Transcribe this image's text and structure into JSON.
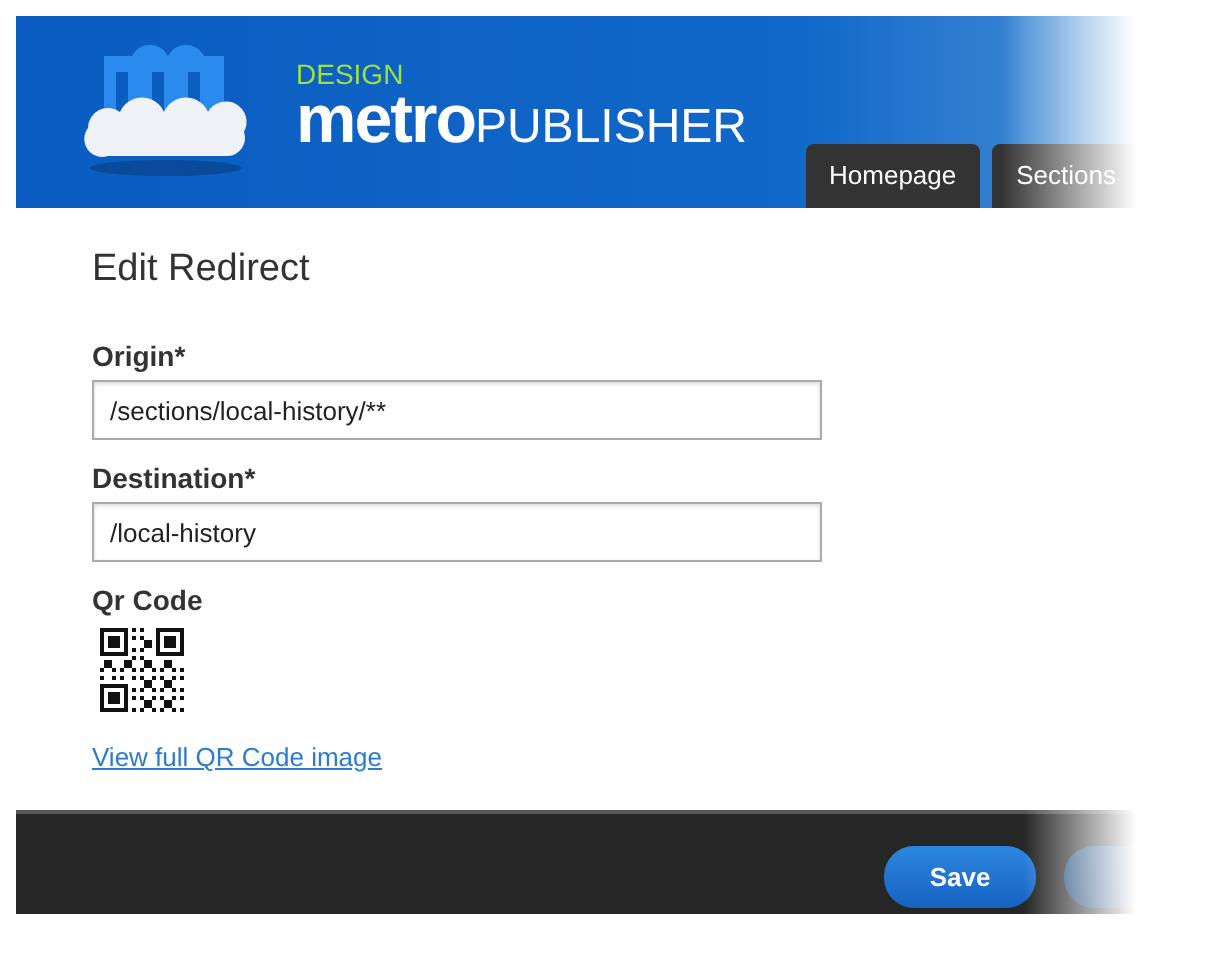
{
  "header": {
    "logo": {
      "tagline": "DESIGN",
      "name_bold": "metro",
      "name_rest": "PUBLISHER"
    },
    "tabs": [
      {
        "label": "Homepage",
        "selected": false
      },
      {
        "label": "Sections",
        "selected": false
      }
    ]
  },
  "form": {
    "title": "Edit Redirect",
    "fields": [
      {
        "kind": "text",
        "label": "Origin*",
        "value": "/sections/local-history/**"
      },
      {
        "kind": "text",
        "label": "Destination*",
        "value": "/local-history"
      },
      {
        "kind": "qr",
        "label": "Qr Code",
        "link": "View full QR Code image"
      }
    ]
  },
  "footer": {
    "buttons": [
      {
        "label": "Save",
        "faded": false
      },
      {
        "faded": true
      }
    ]
  }
}
